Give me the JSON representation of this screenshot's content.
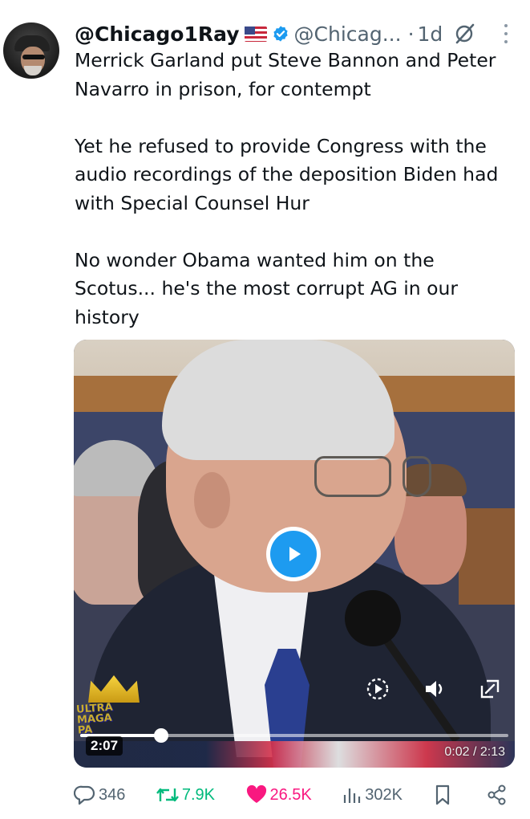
{
  "tweet": {
    "display_name": "@Chicago1Ray",
    "handle": "@Chicag...",
    "separator": "·",
    "time": "1d",
    "text": [
      "Merrick Garland put Steve Bannon and Peter Navarro in prison, for contempt",
      "Yet he refused to provide Congress with the audio recordings of the deposition Biden had with Special Counsel Hur",
      "No wonder Obama wanted him on the Scotus... he's the most corrupt AG in our history"
    ]
  },
  "media": {
    "hover_time": "2:07",
    "time_readout": "0:02 / 2:13",
    "progress_fraction": 0.016,
    "hover_fraction": 0.19,
    "watermark_text": [
      "ULTRA",
      "MAGA",
      "PA"
    ],
    "colors": {
      "play": "#1d9bf0"
    }
  },
  "actions": {
    "replies": "346",
    "retweets": "7.9K",
    "likes": "26.5K",
    "views": "302K"
  },
  "colors": {
    "text": "#0f1419",
    "secondary": "#536471",
    "retweet": "#00ba7c",
    "like": "#f91880",
    "verified": "#1d9bf0"
  },
  "icons": [
    "avatar",
    "us-flag-icon",
    "verified-badge-icon",
    "grok-icon",
    "more-icon",
    "play-icon",
    "replay-icon",
    "volume-icon",
    "fullscreen-icon",
    "reply-icon",
    "retweet-icon",
    "like-icon",
    "views-icon",
    "bookmark-icon",
    "share-icon"
  ]
}
